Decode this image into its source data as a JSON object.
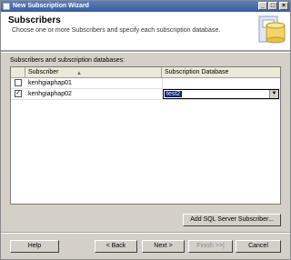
{
  "window": {
    "title": "New Subscription Wizard"
  },
  "header": {
    "title": "Subscribers",
    "subtitle": "Choose one or more Subscribers and specify each subscription database."
  },
  "group": {
    "label": "Subscribers and subscription databases:"
  },
  "grid": {
    "columns": {
      "subscriber": "Subscriber",
      "database": "Subscription Database"
    },
    "rows": [
      {
        "subscriber": "kenhgiaphap01",
        "checked": false,
        "database": ""
      },
      {
        "subscriber": "kenhgiaphap02",
        "checked": true,
        "database": "test2"
      }
    ]
  },
  "buttons": {
    "add": "Add SQL Server Subscriber...",
    "help": "Help",
    "back": "< Back",
    "next": "Next >",
    "finish": "Finish >>|",
    "cancel": "Cancel"
  },
  "icons": {
    "sort": "sort-ascending-icon",
    "dropdown": "chevron-down-icon"
  },
  "colors": {
    "title_bar": "#3a5f9f",
    "selection": "#0a246a"
  }
}
